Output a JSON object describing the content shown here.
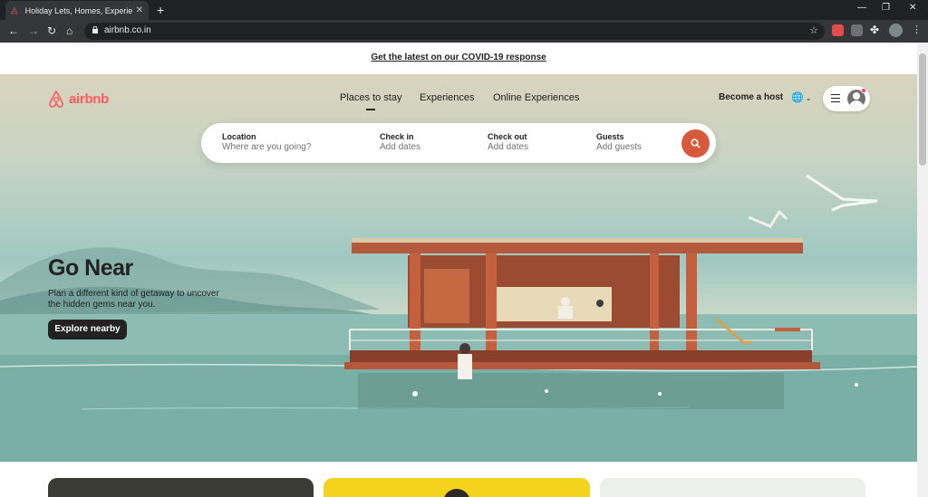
{
  "browser": {
    "tab_title": "Holiday Lets, Homes, Experiences",
    "url": "airbnb.co.in"
  },
  "banner": {
    "text": "Get the latest on our COVID-19 response"
  },
  "header": {
    "brand": "airbnb",
    "nav": [
      "Places to stay",
      "Experiences",
      "Online Experiences"
    ],
    "become_host": "Become a host",
    "brand_color": "#ff5a5f",
    "notification_dot": "#ff385c"
  },
  "search": {
    "location_label": "Location",
    "location_placeholder": "Where are you going?",
    "checkin_label": "Check in",
    "checkin_placeholder": "Add dates",
    "checkout_label": "Check out",
    "checkout_placeholder": "Add dates",
    "guests_label": "Guests",
    "guests_placeholder": "Add guests",
    "button_color": "#d75a3c"
  },
  "hero": {
    "headline": "Go Near",
    "subtitle": "Plan a different kind of getaway to uncover the hidden gems near you.",
    "cta": "Explore nearby"
  },
  "icons": [
    "airbnb-logo-icon",
    "back-icon",
    "forward-icon",
    "reload-icon",
    "home-icon",
    "lock-icon",
    "star-icon",
    "globe-icon",
    "chevron-down-icon",
    "menu-icon",
    "user-icon",
    "search-icon"
  ]
}
